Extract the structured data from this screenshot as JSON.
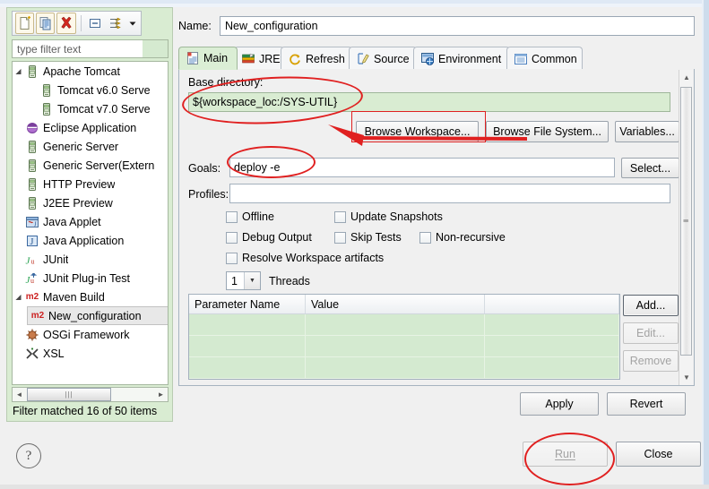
{
  "dialog": {
    "name_label": "Name:",
    "name_value": "New_configuration"
  },
  "toolbar": {
    "buttons": [
      {
        "name": "new-configuration-icon",
        "title": "New launch configuration"
      },
      {
        "name": "duplicate-icon",
        "title": "Duplicate"
      },
      {
        "name": "delete-icon",
        "title": "Delete"
      },
      {
        "name": "collapse-all-icon",
        "title": "Collapse All"
      },
      {
        "name": "filter-icon",
        "title": "Filter"
      },
      {
        "name": "view-menu-arrow-icon",
        "title": "View Menu"
      }
    ]
  },
  "filter": {
    "placeholder": "type filter text",
    "status": "Filter matched 16 of 50 items"
  },
  "tree": [
    {
      "label": "Apache Tomcat",
      "indent": 0,
      "twisty": "open",
      "icon": "server-icon",
      "selected": false
    },
    {
      "label": "Tomcat v6.0 Serve",
      "indent": 1,
      "twisty": "none",
      "icon": "server-icon",
      "selected": false
    },
    {
      "label": "Tomcat v7.0 Serve",
      "indent": 1,
      "twisty": "none",
      "icon": "server-icon",
      "selected": false
    },
    {
      "label": "Eclipse Application",
      "indent": 0,
      "twisty": "none",
      "icon": "eclipse-icon",
      "selected": false
    },
    {
      "label": "Generic Server",
      "indent": 0,
      "twisty": "none",
      "icon": "server-icon",
      "selected": false
    },
    {
      "label": "Generic Server(Extern",
      "indent": 0,
      "twisty": "none",
      "icon": "server-icon",
      "selected": false
    },
    {
      "label": "HTTP Preview",
      "indent": 0,
      "twisty": "none",
      "icon": "server-icon",
      "selected": false
    },
    {
      "label": "J2EE Preview",
      "indent": 0,
      "twisty": "none",
      "icon": "server-icon",
      "selected": false
    },
    {
      "label": "Java Applet",
      "indent": 0,
      "twisty": "none",
      "icon": "java-applet-icon",
      "selected": false
    },
    {
      "label": "Java Application",
      "indent": 0,
      "twisty": "none",
      "icon": "java-app-icon",
      "selected": false
    },
    {
      "label": "JUnit",
      "indent": 0,
      "twisty": "none",
      "icon": "junit-icon",
      "selected": false
    },
    {
      "label": "JUnit Plug-in Test",
      "indent": 0,
      "twisty": "none",
      "icon": "junit-plugin-icon",
      "selected": false
    },
    {
      "label": "Maven Build",
      "indent": 0,
      "twisty": "open",
      "icon": "m2-icon",
      "selected": false
    },
    {
      "label": "New_configuration",
      "indent": 1,
      "twisty": "none",
      "icon": "m2-icon",
      "selected": true
    },
    {
      "label": "OSGi Framework",
      "indent": 0,
      "twisty": "none",
      "icon": "osgi-icon",
      "selected": false
    },
    {
      "label": "XSL",
      "indent": 0,
      "twisty": "none",
      "icon": "xsl-icon",
      "selected": false
    }
  ],
  "tabs": [
    {
      "label": "Main",
      "icon": "main-tab-icon",
      "active": true
    },
    {
      "label": "JRE",
      "icon": "jre-tab-icon",
      "active": false
    },
    {
      "label": "Refresh",
      "icon": "refresh-tab-icon",
      "active": false
    },
    {
      "label": "Source",
      "icon": "source-tab-icon",
      "active": false
    },
    {
      "label": "Environment",
      "icon": "environment-tab-icon",
      "active": false
    },
    {
      "label": "Common",
      "icon": "common-tab-icon",
      "active": false
    }
  ],
  "main_tab": {
    "base_directory_label": "Base directory:",
    "base_directory_value": "${workspace_loc:/SYS-UTIL}",
    "browse_workspace_label": "Browse Workspace...",
    "browse_file_system_label": "Browse File System...",
    "variables_label": "Variables...",
    "goals_label": "Goals:",
    "goals_value": "deploy -e",
    "select_label": "Select...",
    "profiles_label": "Profiles:",
    "profiles_value": "",
    "checkboxes": [
      {
        "label": "Offline",
        "checked": false
      },
      {
        "label": "Update Snapshots",
        "checked": false
      },
      {
        "label": "Debug Output",
        "checked": false
      },
      {
        "label": "Skip Tests",
        "checked": false
      },
      {
        "label": "Non-recursive",
        "checked": false
      },
      {
        "label": "Resolve Workspace artifacts",
        "checked": false
      }
    ],
    "threads_value": "1",
    "threads_label": "Threads",
    "table": {
      "headers": [
        "Parameter Name",
        "Value",
        ""
      ],
      "rows": [
        [
          "",
          "",
          ""
        ],
        [
          "",
          "",
          ""
        ],
        [
          "",
          "",
          ""
        ]
      ]
    },
    "add_label": "Add...",
    "edit_label": "Edit...",
    "remove_label": "Remove"
  },
  "footer": {
    "apply_label": "Apply",
    "revert_label": "Revert",
    "run_label": "Run",
    "close_label": "Close",
    "help_label": "?"
  },
  "colors": {
    "accent_green": "#d9ecd2",
    "annotation_red": "#e02020",
    "delete_red": "#d4291f"
  }
}
